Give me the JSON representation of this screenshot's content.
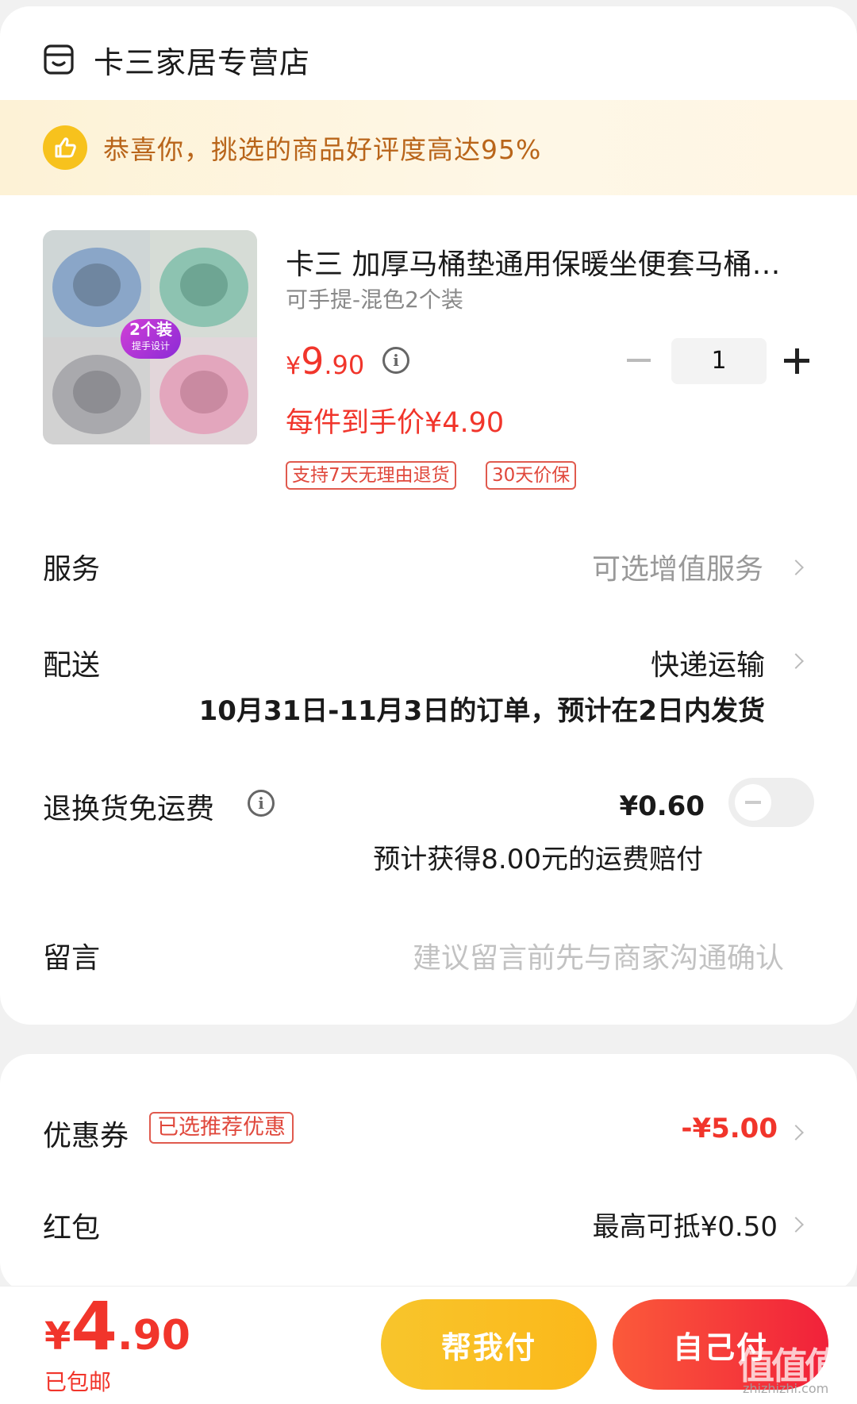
{
  "store": {
    "name": "卡三家居专营店",
    "icon": "store-icon"
  },
  "banner": {
    "text": "恭喜你，挑选的商品好评度高达95%",
    "icon": "thumbs-up-icon",
    "color": "#b9651a"
  },
  "product": {
    "title": "卡三 加厚马桶垫通用保暖坐便套马桶…",
    "sku": "可手提-混色2个装",
    "price_yen": "¥",
    "price_int": "9",
    "price_dec": ".90",
    "per_unit": "每件到手价¥4.90",
    "tags": [
      "支持7天无理由退货",
      "30天价保"
    ],
    "quantity": "1",
    "image_badge_1": "2个装",
    "image_badge_2": "提手设计"
  },
  "rows": {
    "service": {
      "label": "服务",
      "value": "可选增值服务"
    },
    "delivery": {
      "label": "配送",
      "value": "快递运输",
      "note": "10月31日-11月3日的订单，预计在2日内发货"
    },
    "return_freight": {
      "label": "退换货免运费",
      "value": "¥0.60",
      "note": "预计获得8.00元的运费赔付",
      "toggle_on": false
    },
    "message": {
      "label": "留言",
      "placeholder": "建议留言前先与商家沟通确认"
    },
    "coupon": {
      "label": "优惠券",
      "tag": "已选推荐优惠",
      "value": "-¥5.00"
    },
    "redpacket": {
      "label": "红包",
      "value": "最高可抵¥0.50"
    }
  },
  "footer": {
    "total_yen": "¥",
    "total_int": "4",
    "total_dec": ".90",
    "shipping": "已包邮",
    "btn_help": "帮我付",
    "btn_self": "自己付"
  },
  "watermark": {
    "text": "值值值",
    "sub": "zhizhizhi.com"
  },
  "colors": {
    "accent_red": "#f1352b",
    "accent_yellow": "#f8c52c",
    "banner_bg": "#fdf2d6"
  }
}
